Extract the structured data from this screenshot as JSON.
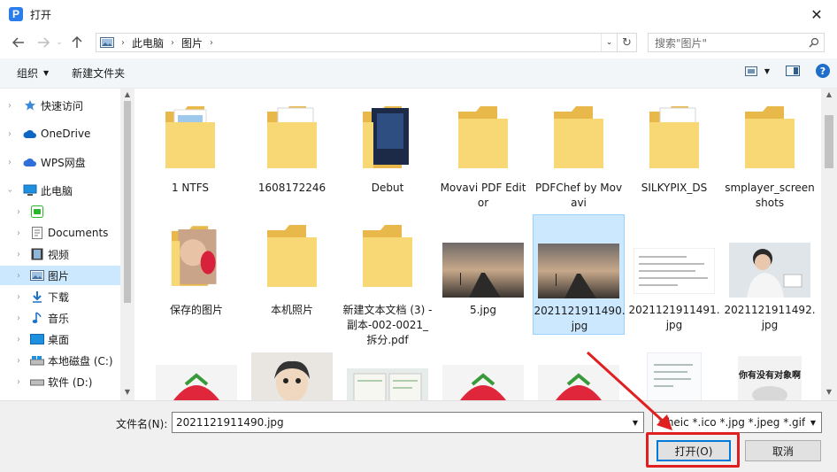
{
  "window": {
    "title": "打开",
    "close_glyph": "✕"
  },
  "address": {
    "crumbs": [
      "此电脑",
      "图片"
    ],
    "search_placeholder": "搜索\"图片\""
  },
  "toolbar": {
    "organize": "组织",
    "new_folder": "新建文件夹"
  },
  "sidebar": {
    "items": [
      {
        "label": "快速访问",
        "icon": "star-icon"
      },
      {
        "label": "OneDrive",
        "icon": "cloud-icon"
      },
      {
        "label": "WPS网盘",
        "icon": "cloud-icon"
      },
      {
        "label": "此电脑",
        "icon": "computer-icon"
      },
      {
        "label": "",
        "icon": "app-icon"
      },
      {
        "label": "Documents",
        "icon": "document-icon"
      },
      {
        "label": "视频",
        "icon": "video-icon"
      },
      {
        "label": "图片",
        "icon": "pictures-icon"
      },
      {
        "label": "下载",
        "icon": "download-icon"
      },
      {
        "label": "音乐",
        "icon": "music-icon"
      },
      {
        "label": "桌面",
        "icon": "desktop-icon"
      },
      {
        "label": "本地磁盘 (C:)",
        "icon": "drive-icon"
      },
      {
        "label": "软件 (D:)",
        "icon": "drive-icon"
      }
    ]
  },
  "files": [
    {
      "name": "1 NTFS",
      "kind": "folder"
    },
    {
      "name": "1608172246",
      "kind": "folder-doc"
    },
    {
      "name": "Debut",
      "kind": "folder-app"
    },
    {
      "name": "Movavi PDF Editor",
      "kind": "folder"
    },
    {
      "name": "PDFChef by Movavi",
      "kind": "folder"
    },
    {
      "name": "SILKYPIX_DS",
      "kind": "folder-doc"
    },
    {
      "name": "smplayer_screenshots",
      "kind": "folder"
    },
    {
      "name": "保存的图片",
      "kind": "folder-photo"
    },
    {
      "name": "本机照片",
      "kind": "folder"
    },
    {
      "name": "新建文本文档 (3) - 副本-002-0021_拆分.pdf",
      "kind": "folder"
    },
    {
      "name": "5.jpg",
      "kind": "photo-road"
    },
    {
      "name": "2021121911490.jpg",
      "kind": "photo-road"
    },
    {
      "name": "2021121911491.jpg",
      "kind": "photo-doc"
    },
    {
      "name": "2021121911492.jpg",
      "kind": "photo-person"
    },
    {
      "name": "",
      "kind": "photo-strawberry"
    },
    {
      "name": "",
      "kind": "photo-drawing"
    },
    {
      "name": "",
      "kind": "photo-card"
    },
    {
      "name": "",
      "kind": "photo-strawberry"
    },
    {
      "name": "",
      "kind": "photo-strawberry"
    },
    {
      "name": "",
      "kind": "photo-note"
    },
    {
      "name": "",
      "kind": "photo-meme"
    }
  ],
  "meme_text": "你有没有对象啊",
  "bottom": {
    "filename_label": "文件名(N):",
    "filename_value": "2021121911490.jpg",
    "filetype": "*.heic *.ico *.jpg *.jpeg *.gif *",
    "open_label": "打开(O)",
    "cancel_label": "取消"
  },
  "colors": {
    "selection": "#cce8ff",
    "accent": "#0078d7",
    "folder": "#f8d775",
    "annotation": "#e02020"
  }
}
